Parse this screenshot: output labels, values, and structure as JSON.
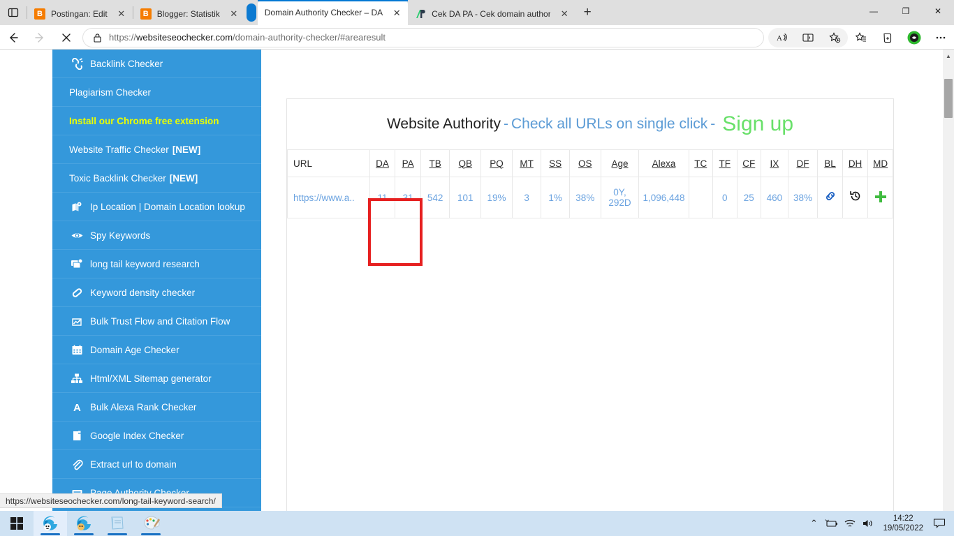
{
  "browser": {
    "tabs": [
      {
        "title": "Postingan: Edit",
        "favicon": "blogger-icon",
        "active": false,
        "close_label": "✕"
      },
      {
        "title": "Blogger: Statistik",
        "favicon": "blogger-icon",
        "active": false,
        "close_label": "✕"
      },
      {
        "title": "Domain Authority Checker – DA",
        "favicon": "none",
        "active": true,
        "close_label": "✕"
      },
      {
        "title": "Cek DA PA - Cek domain authori",
        "favicon": "pr-icon",
        "active": false,
        "close_label": "✕"
      }
    ],
    "new_tab_label": "+",
    "window_controls": {
      "minimize": "—",
      "maximize": "❐",
      "close": "✕"
    },
    "nav": {
      "back": "←",
      "forward": "→",
      "stop": "✕",
      "lock_icon": "lock-icon"
    },
    "address": {
      "full_url": "https://websiteseochecker.com/domain-authority-checker/#arearesult",
      "scheme": "https://",
      "host": "websiteseochecker.com",
      "path": "/domain-authority-checker/#arearesult"
    },
    "toolbar_right": [
      "read-aloud-icon",
      "immersive-reader-icon",
      "add-favorite-icon",
      "favorites-icon",
      "collections-icon",
      "extension-icon",
      "settings-more-icon"
    ]
  },
  "sidebar": {
    "items": [
      {
        "label": "Backlink Checker",
        "icon": "backlink-icon",
        "highlight": false,
        "badge": ""
      },
      {
        "label": "Plagiarism Checker",
        "icon": "",
        "highlight": false,
        "badge": ""
      },
      {
        "label": "Install our Chrome free extension",
        "icon": "",
        "highlight": true,
        "badge": ""
      },
      {
        "label": "Website Traffic Checker",
        "icon": "",
        "highlight": false,
        "badge": "[NEW]"
      },
      {
        "label": "Toxic Backlink Checker",
        "icon": "",
        "highlight": false,
        "badge": "[NEW]"
      },
      {
        "label": "Ip Location | Domain Location lookup",
        "icon": "map-pin-icon",
        "highlight": false,
        "badge": ""
      },
      {
        "label": "Spy Keywords",
        "icon": "eye-icon",
        "highlight": false,
        "badge": ""
      },
      {
        "label": "long tail keyword research",
        "icon": "cards-icon",
        "highlight": false,
        "badge": ""
      },
      {
        "label": "Keyword density checker",
        "icon": "pill-icon",
        "highlight": false,
        "badge": ""
      },
      {
        "label": "Bulk Trust Flow and Citation Flow",
        "icon": "chart-icon",
        "highlight": false,
        "badge": ""
      },
      {
        "label": "Domain Age Checker",
        "icon": "calendar-icon",
        "highlight": false,
        "badge": ""
      },
      {
        "label": "Html/XML Sitemap generator",
        "icon": "sitemap-icon",
        "highlight": false,
        "badge": ""
      },
      {
        "label": "Bulk Alexa Rank Checker",
        "icon": "alexa-a-icon",
        "highlight": false,
        "badge": ""
      },
      {
        "label": "Google Index Checker",
        "icon": "document-icon",
        "highlight": false,
        "badge": ""
      },
      {
        "label": "Extract url to domain",
        "icon": "paperclip-icon",
        "highlight": false,
        "badge": ""
      },
      {
        "label": "Page Authority Checker",
        "icon": "list-icon",
        "highlight": false,
        "badge": ""
      }
    ]
  },
  "main": {
    "heading": {
      "part1": "Website Authority",
      "dash1": "-",
      "part2": "Check all URLs on single click",
      "dash2": "-",
      "cta": "Sign up"
    },
    "table": {
      "columns": [
        {
          "key": "URL",
          "underline": false
        },
        {
          "key": "DA",
          "underline": true
        },
        {
          "key": "PA",
          "underline": true
        },
        {
          "key": "TB",
          "underline": true
        },
        {
          "key": "QB",
          "underline": true
        },
        {
          "key": "PQ",
          "underline": true
        },
        {
          "key": "MT",
          "underline": true
        },
        {
          "key": "SS",
          "underline": true
        },
        {
          "key": "OS",
          "underline": true
        },
        {
          "key": "Age",
          "underline": true
        },
        {
          "key": "Alexa",
          "underline": true
        },
        {
          "key": "TC",
          "underline": true
        },
        {
          "key": "TF",
          "underline": true
        },
        {
          "key": "CF",
          "underline": true
        },
        {
          "key": "IX",
          "underline": true
        },
        {
          "key": "DF",
          "underline": true
        },
        {
          "key": "BL",
          "underline": true
        },
        {
          "key": "DH",
          "underline": true
        },
        {
          "key": "MD",
          "underline": true
        }
      ],
      "rows": [
        {
          "URL": "https://www.a..",
          "DA": "11",
          "PA": "31",
          "TB": "542",
          "QB": "101",
          "PQ": "19%",
          "MT": "3",
          "SS": "1%",
          "OS": "38%",
          "Age": "0Y, 292D",
          "Alexa": "1,096,448",
          "TC": "",
          "TF": "0",
          "CF": "25",
          "IX": "460",
          "DF": "38%",
          "BL": "link-icon",
          "DH": "history-icon",
          "MD": "plus-icon"
        }
      ]
    },
    "highlight_box": {
      "color": "#e62020",
      "covers": "DA, PA"
    }
  },
  "status_bar": {
    "url": "https://websiteseochecker.com/long-tail-keyword-search/"
  },
  "taskbar": {
    "start_label": "start-icon",
    "apps": [
      {
        "name": "edge-browser-1",
        "active": true
      },
      {
        "name": "edge-browser-2",
        "active": false
      },
      {
        "name": "notepad-app",
        "active": false
      },
      {
        "name": "paint-app",
        "active": false
      }
    ],
    "tray": {
      "chevron": "⌃",
      "icons": [
        "battery-icon",
        "wifi-icon",
        "volume-icon"
      ],
      "time": "14:22",
      "date": "19/05/2022",
      "notification": "notification-icon"
    }
  },
  "colors": {
    "sidebar_blue": "#3498db",
    "accent_green": "#69e06a",
    "highlight_yellow": "#eaff00",
    "table_value_blue": "#6ba3e0",
    "red_box": "#e62020"
  }
}
